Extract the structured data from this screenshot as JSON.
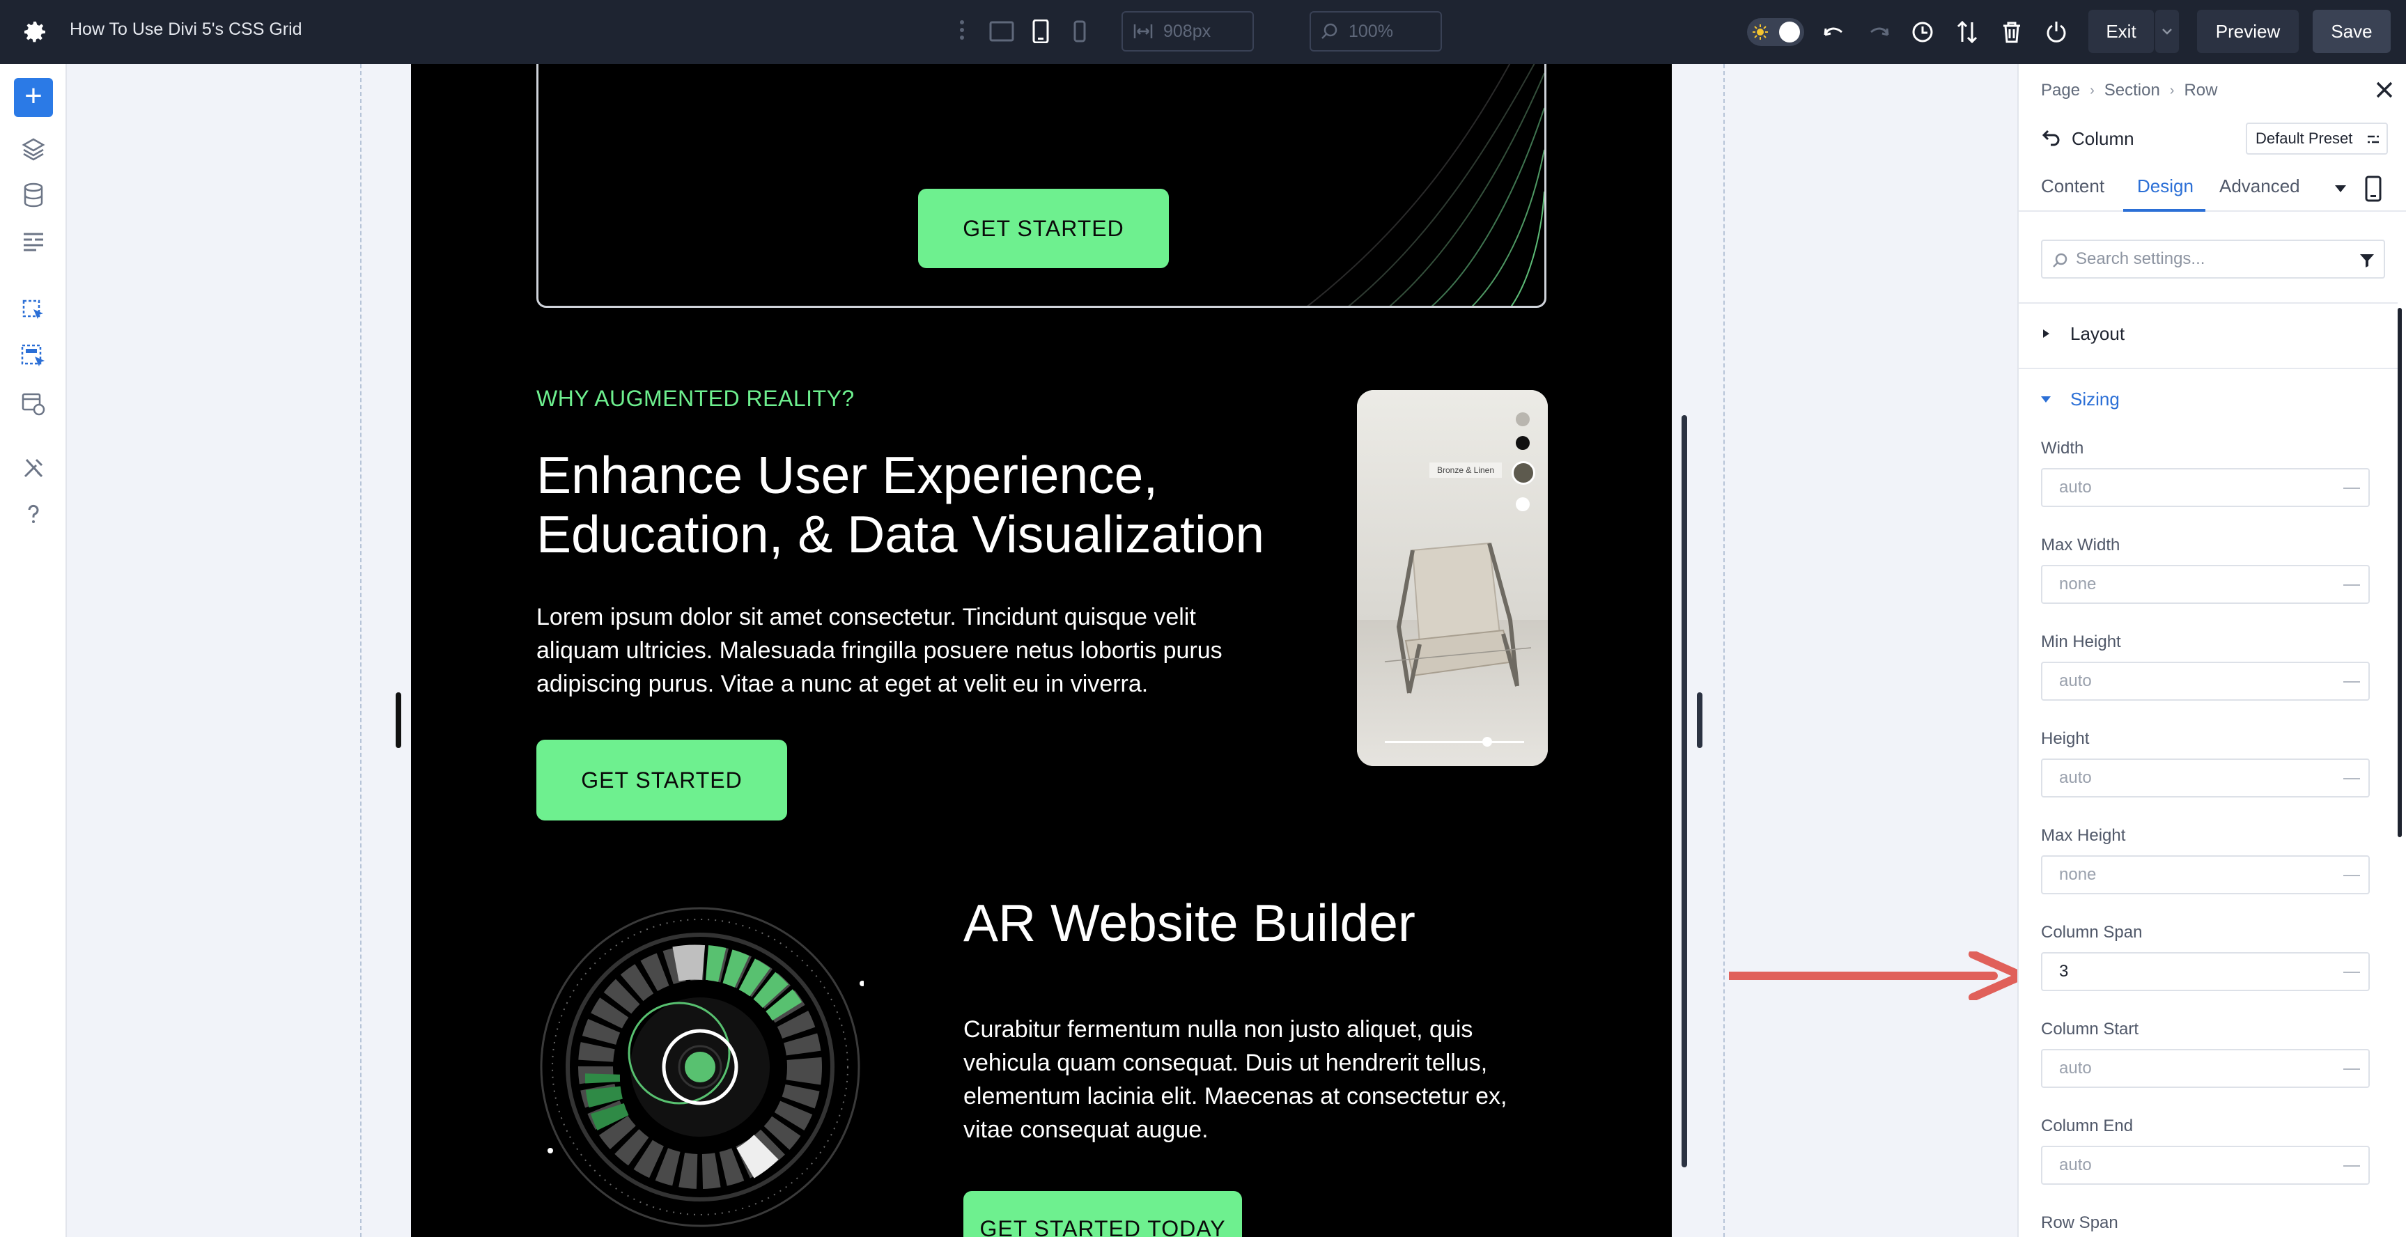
{
  "topbar": {
    "title": "How To Use Divi 5's CSS Grid",
    "width_field": "908px",
    "zoom_field": "100%",
    "exit_label": "Exit",
    "preview_label": "Preview",
    "save_label": "Save"
  },
  "canvas": {
    "hero_cta": "GET STARTED",
    "eyebrow": "WHY AUGMENTED REALITY?",
    "heading1": "Enhance User Experience, Education, & Data Visualization",
    "body1": "Lorem ipsum dolor sit amet consectetur. Tincidunt quisque velit aliquam ultricies. Malesuada fringilla posuere netus lobortis purus adipiscing purus. Vitae a nunc at eget at velit eu in viverra.",
    "cta2": "GET STARTED",
    "phone_tag": "Bronze & Linen",
    "heading2": "AR Website Builder",
    "body2": "Curabitur fermentum nulla non justo aliquet, quis vehicula quam consequat. Duis ut hendrerit tellus, elementum lacinia elit. Maecenas at consectetur ex, vitae consequat augue.",
    "cta3": "GET STARTED TODAY"
  },
  "panel": {
    "breadcrumbs": [
      "Page",
      "Section",
      "Row"
    ],
    "title": "Column",
    "preset": "Default Preset",
    "tabs": [
      "Content",
      "Design",
      "Advanced"
    ],
    "search_placeholder": "Search settings...",
    "sections": {
      "layout": "Layout",
      "sizing": "Sizing"
    },
    "fields": [
      {
        "label": "Width",
        "value": "auto"
      },
      {
        "label": "Max Width",
        "value": "none"
      },
      {
        "label": "Min Height",
        "value": "auto"
      },
      {
        "label": "Height",
        "value": "auto"
      },
      {
        "label": "Max Height",
        "value": "none"
      },
      {
        "label": "Column Span",
        "value": "3"
      },
      {
        "label": "Column Start",
        "value": "auto"
      },
      {
        "label": "Column End",
        "value": "auto"
      },
      {
        "label": "Row Span",
        "value": ""
      }
    ]
  },
  "colors": {
    "accent": "#6ef08f",
    "brand_blue": "#2b6fd6",
    "arrow": "#e0605a"
  }
}
